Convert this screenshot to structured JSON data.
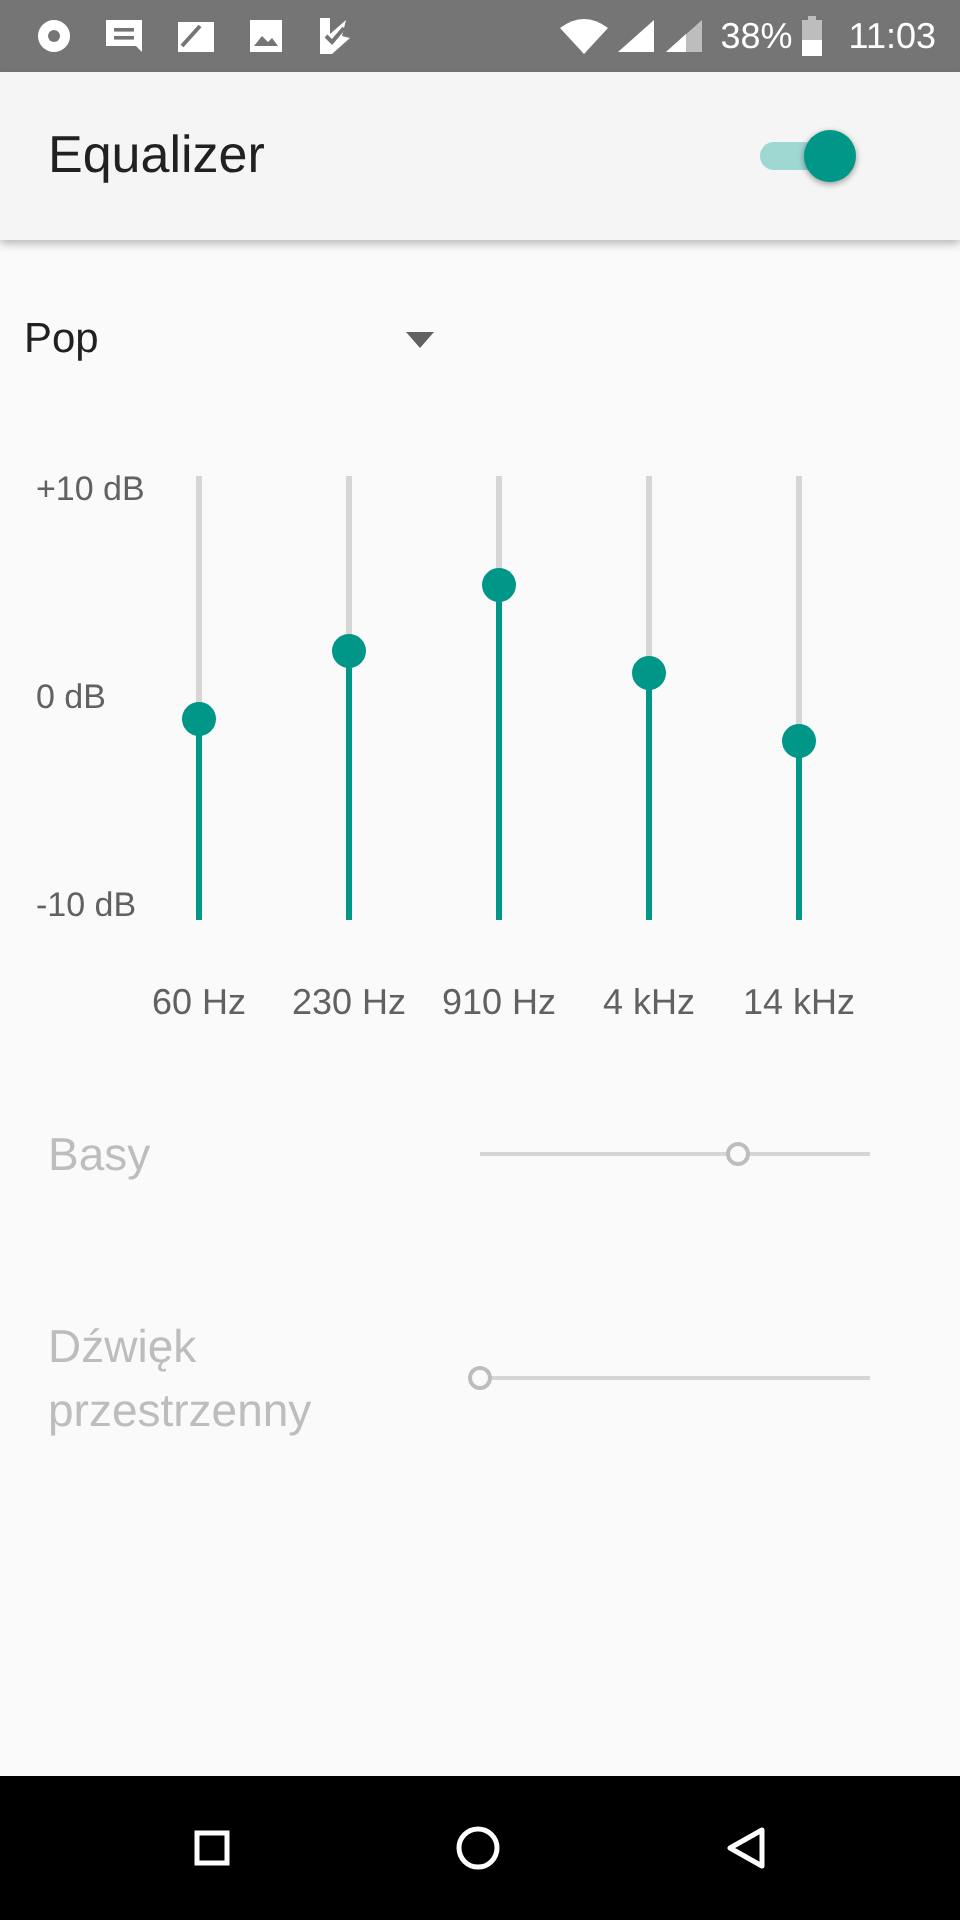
{
  "status_bar": {
    "battery": "38%",
    "time": "11:03"
  },
  "app_bar": {
    "title": "Equalizer",
    "switch": {
      "on": true
    }
  },
  "preset": {
    "value": "Pop"
  },
  "equalizer": {
    "db_labels": [
      "+10 dB",
      "0 dB",
      "-10 dB"
    ],
    "bands": [
      {
        "label": "60 Hz",
        "level": 0.45
      },
      {
        "label": "230 Hz",
        "level": 0.6
      },
      {
        "label": "910 Hz",
        "level": 0.75
      },
      {
        "label": "4 kHz",
        "level": 0.55
      },
      {
        "label": "14 kHz",
        "level": 0.4
      }
    ]
  },
  "effects": [
    {
      "label": "Basy",
      "level": 0.66,
      "disabled": true
    },
    {
      "label": "Dźwięk przestrzenny",
      "level": 0,
      "disabled": true
    }
  ]
}
